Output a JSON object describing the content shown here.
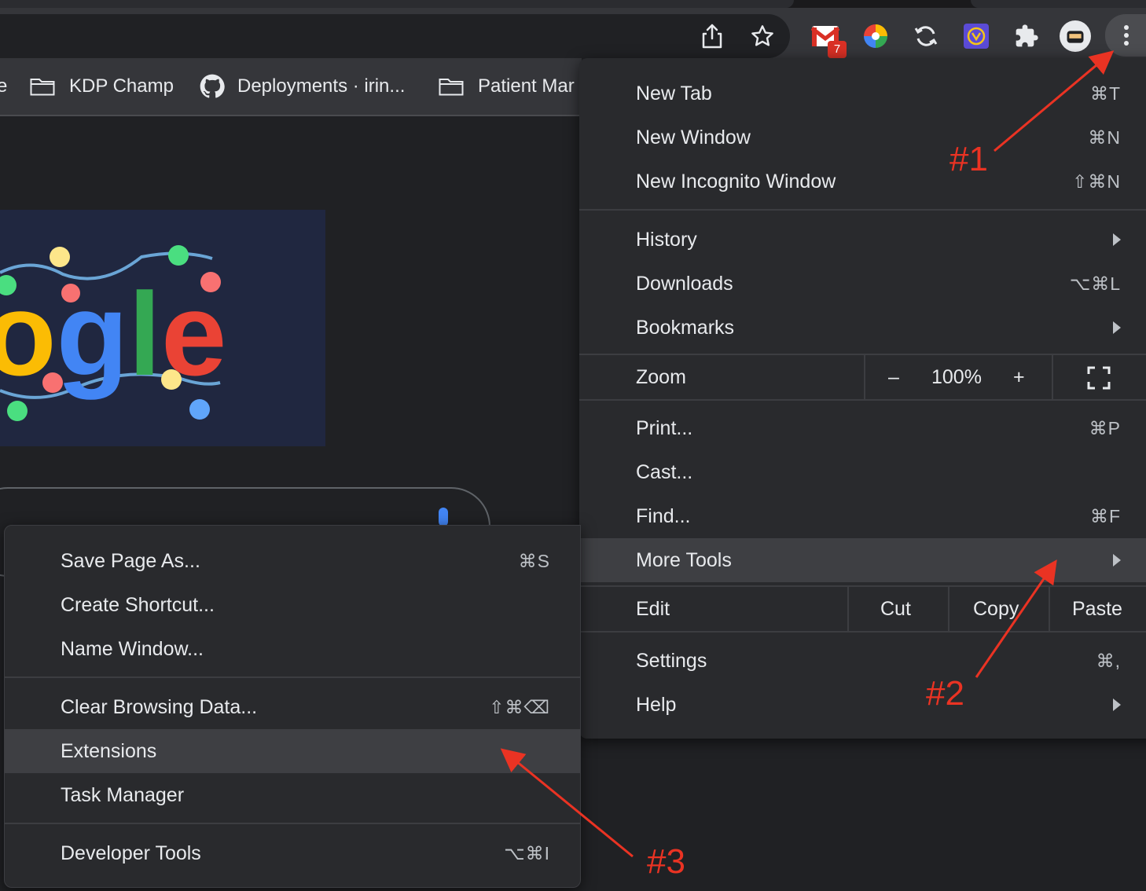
{
  "toolbar": {
    "share_icon": "share-icon",
    "star_icon": "bookmark-star-icon",
    "gmail_badge": "7",
    "menu_icon": "three-dot-menu-icon"
  },
  "bookmarks": [
    {
      "label": "e"
    },
    {
      "label": "KDP Champ"
    },
    {
      "label": "Deployments · irin..."
    },
    {
      "label": "Patient Mar"
    }
  ],
  "main_menu": {
    "items": [
      {
        "label": "New Tab",
        "shortcut": "⌘T"
      },
      {
        "label": "New Window",
        "shortcut": "⌘N"
      },
      {
        "label": "New Incognito Window",
        "shortcut": "⇧⌘N"
      },
      {
        "label": "History",
        "shortcut": ""
      },
      {
        "label": "Downloads",
        "shortcut": "⌥⌘L"
      },
      {
        "label": "Bookmarks",
        "shortcut": ""
      },
      {
        "label": "Print...",
        "shortcut": "⌘P"
      },
      {
        "label": "Cast...",
        "shortcut": ""
      },
      {
        "label": "Find...",
        "shortcut": "⌘F"
      },
      {
        "label": "More Tools",
        "shortcut": ""
      },
      {
        "label": "Settings",
        "shortcut": "⌘,"
      },
      {
        "label": "Help",
        "shortcut": ""
      }
    ],
    "zoom": {
      "label": "Zoom",
      "minus": "–",
      "value": "100%",
      "plus": "+"
    },
    "edit": {
      "label": "Edit",
      "cut": "Cut",
      "copy": "Copy",
      "paste": "Paste"
    }
  },
  "sub_menu": {
    "items": [
      {
        "label": "Save Page As...",
        "shortcut": "⌘S"
      },
      {
        "label": "Create Shortcut...",
        "shortcut": ""
      },
      {
        "label": "Name Window...",
        "shortcut": ""
      },
      {
        "label": "Clear Browsing Data...",
        "shortcut": "⇧⌘⌫"
      },
      {
        "label": "Extensions",
        "shortcut": ""
      },
      {
        "label": "Task Manager",
        "shortcut": ""
      },
      {
        "label": "Developer Tools",
        "shortcut": "⌥⌘I"
      }
    ]
  },
  "annotations": {
    "a1": "#1",
    "a2": "#2",
    "a3": "#3",
    "color": "#ea3323"
  },
  "doodle": {
    "text": "ogle"
  }
}
